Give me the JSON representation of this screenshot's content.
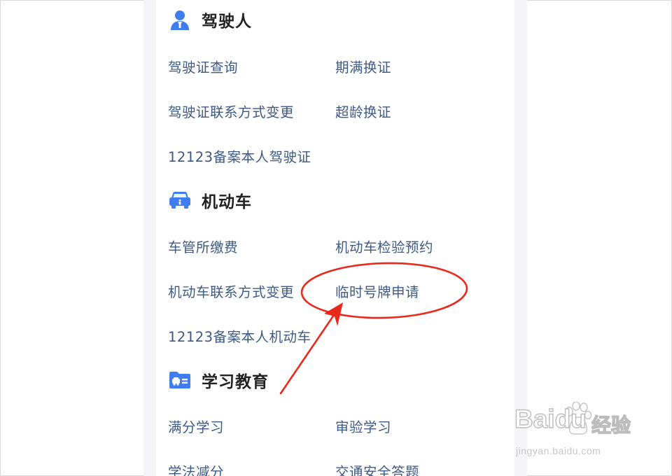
{
  "colors": {
    "link": "#3d5a86",
    "icon_blue": "#3f7df0",
    "annotation_red": "#e8291c",
    "title": "#222222"
  },
  "sections": [
    {
      "title": "驾驶人",
      "icon": "driver-person-icon",
      "items": [
        "驾驶证查询",
        "期满换证",
        "驾驶证联系方式变更",
        "超龄换证",
        "12123备案本人驾驶证"
      ]
    },
    {
      "title": "机动车",
      "icon": "car-icon",
      "items": [
        "车管所缴费",
        "机动车检验预约",
        "机动车联系方式变更",
        "临时号牌申请",
        "12123备案本人机动车"
      ]
    },
    {
      "title": "学习教育",
      "icon": "study-folder-icon",
      "items": [
        "满分学习",
        "审验学习",
        "学法减分",
        "交通安全答题"
      ]
    }
  ],
  "annotation": {
    "highlighted_item": "临时号牌申请",
    "shapes": [
      "red-ellipse",
      "red-arrow"
    ]
  },
  "watermark": {
    "brand": "Baidu",
    "suffix": "经验",
    "url": "jingyan.baidu.com"
  }
}
